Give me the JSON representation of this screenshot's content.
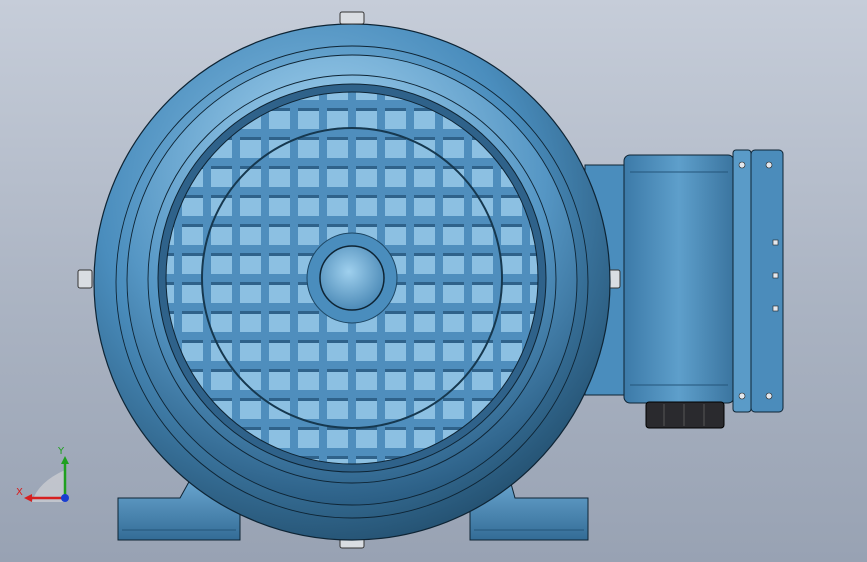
{
  "viewport": {
    "colors": {
      "background_top": "#c6cdd9",
      "background_bottom": "#98a2b3",
      "body_blue": "#4a8dbd",
      "body_dark": "#1d4663",
      "body_light": "#9fd0ee",
      "outline": "#0e2434"
    }
  },
  "model": {
    "parts": [
      "motor-housing",
      "fan-cover-grille",
      "terminal-box",
      "mounting-feet",
      "cable-gland",
      "lifting-bolt"
    ]
  },
  "triad": {
    "x_label": "X",
    "y_label": "Y",
    "x_color": "#d62020",
    "y_color": "#1fa01f",
    "z_color": "#1a3fd0"
  }
}
